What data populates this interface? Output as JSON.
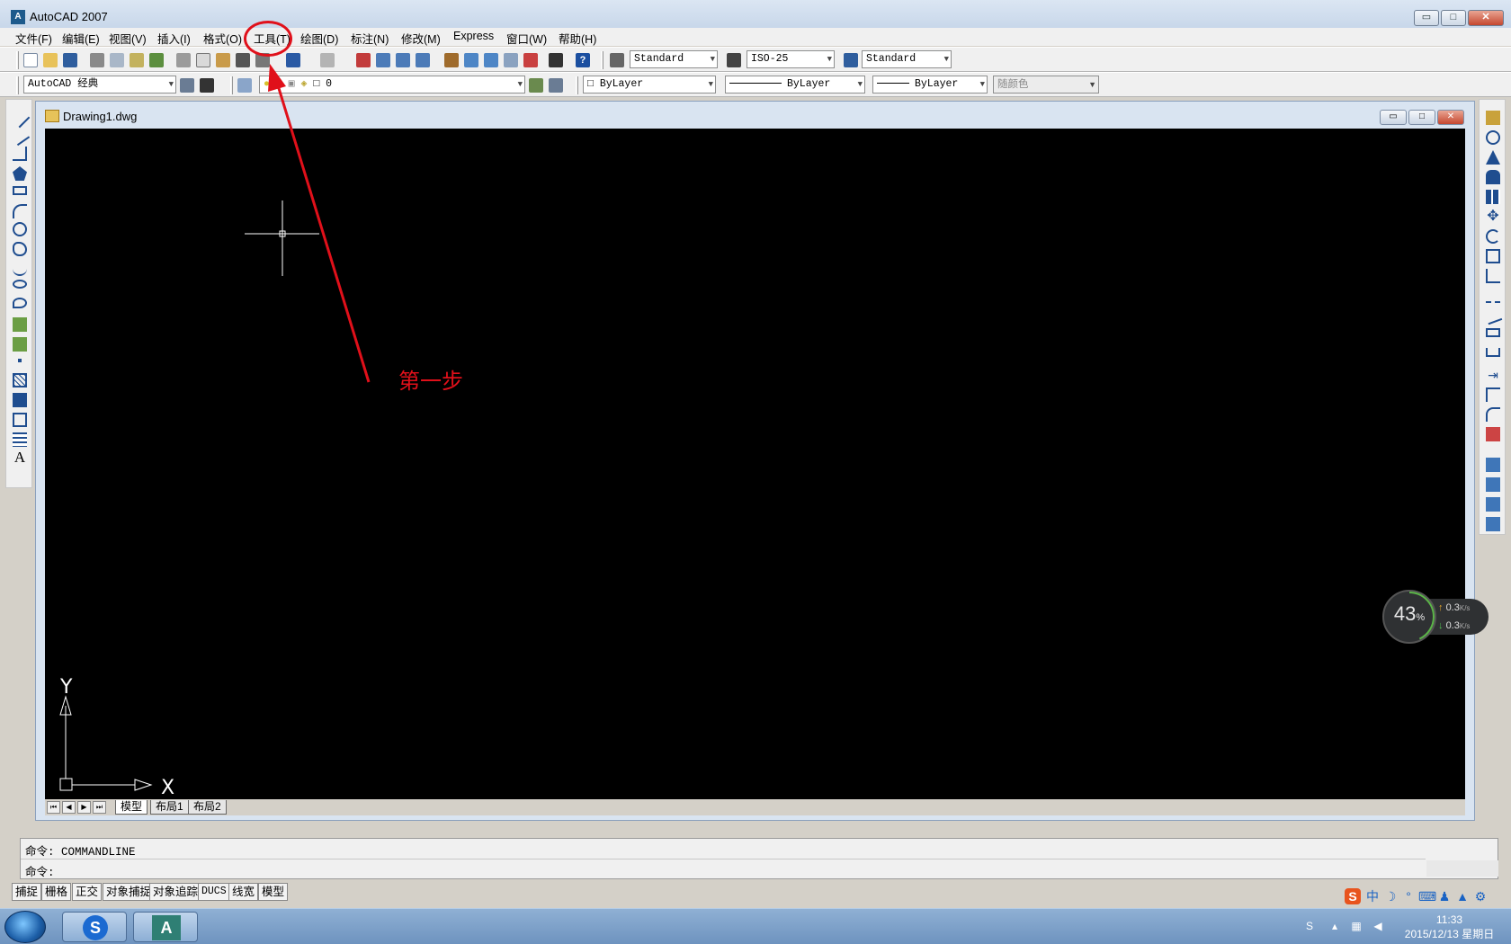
{
  "window": {
    "title": "AutoCAD 2007",
    "app_icon_glyph": "A",
    "minimize": "▭",
    "maximize": "□",
    "close": "✕"
  },
  "menu": [
    {
      "label": "文件(F)",
      "name": "file"
    },
    {
      "label": "编辑(E)",
      "name": "edit"
    },
    {
      "label": "视图(V)",
      "name": "view"
    },
    {
      "label": "插入(I)",
      "name": "insert"
    },
    {
      "label": "格式(O)",
      "name": "format"
    },
    {
      "label": "工具(T)",
      "name": "tools"
    },
    {
      "label": "绘图(D)",
      "name": "draw"
    },
    {
      "label": "标注(N)",
      "name": "dimension"
    },
    {
      "label": "修改(M)",
      "name": "modify"
    },
    {
      "label": "Express",
      "name": "express"
    },
    {
      "label": "窗口(W)",
      "name": "window"
    },
    {
      "label": "帮助(H)",
      "name": "help"
    }
  ],
  "toolbar1": {
    "text_style": "Standard",
    "dim_style": "ISO-25",
    "table_style": "Standard"
  },
  "toolbar2": {
    "workspace": "AutoCAD 经典",
    "layer": "0",
    "color": "ByLayer",
    "linetype": "ByLayer",
    "lineweight": "ByLayer",
    "plotstyle": "随颜色"
  },
  "drawing": {
    "title": "Drawing1.dwg",
    "ucs_x": "X",
    "ucs_y": "Y",
    "canvas_color": "#000000",
    "crosshair_color": "#ffffff"
  },
  "layout_tabs": [
    "模型",
    "布局1",
    "布局2"
  ],
  "nav_buttons": [
    "⏮",
    "◀",
    "▶",
    "⏭"
  ],
  "command": {
    "history_line": "命令: COMMANDLINE",
    "prompt": "命令:"
  },
  "status_buttons": [
    "捕捉",
    "栅格",
    "正交",
    "对象捕捉",
    "对象追踪",
    "DUCS",
    "线宽",
    "模型"
  ],
  "annotation": {
    "step_label": "第一步",
    "color": "#e0101a"
  },
  "speed_widget": {
    "percent": "43",
    "percent_sign": "%",
    "up_rate": "0.3",
    "down_rate": "0.3",
    "unit": "K/s",
    "up_arrow": "↑",
    "down_arrow": "↓"
  },
  "ime": {
    "logo": "S",
    "lang": "中"
  },
  "clock": {
    "time": "11:33",
    "date": "2015/12/13 星期日"
  }
}
